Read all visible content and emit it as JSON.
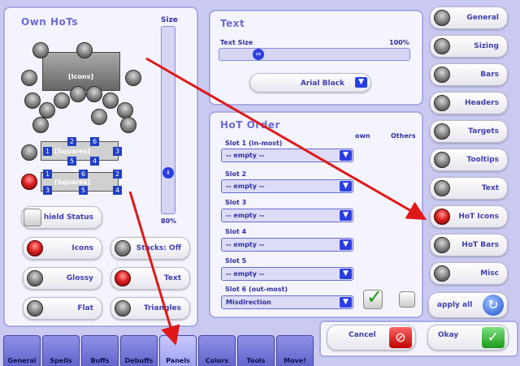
{
  "own_hots": {
    "title": "Own HoTs",
    "size_label": "Size",
    "size_value": "80%",
    "icons_label": "[Icons]",
    "squares_label": "[Squares]",
    "squares_row1_top": [
      "2",
      "6"
    ],
    "squares_row1_mid": [
      "1",
      "3"
    ],
    "squares_row1_bot": [
      "5",
      "4"
    ],
    "squares_row2_top": [
      "1",
      "6",
      "2"
    ],
    "squares_row2_bot": [
      "3",
      "5",
      "4"
    ],
    "shield_label": "hield Status",
    "toggles": [
      {
        "label": "Icons",
        "state": "red"
      },
      {
        "label": "Stacks: Off",
        "state": "grey"
      },
      {
        "label": "Glossy",
        "state": "grey"
      },
      {
        "label": "Text",
        "state": "red"
      },
      {
        "label": "Flat",
        "state": "grey"
      },
      {
        "label": "Triangles",
        "state": "grey"
      }
    ]
  },
  "text_panel": {
    "title": "Text",
    "size_label": "Text Size",
    "size_value": "100%",
    "font_value": "Arial Black"
  },
  "hot_order": {
    "title": "HoT Order",
    "col_own": "own",
    "col_others": "Others",
    "slots": [
      {
        "label": "Slot 1 (in-most)",
        "value": "-- empty --"
      },
      {
        "label": "Slot 2",
        "value": "-- empty --"
      },
      {
        "label": "Slot 3",
        "value": "-- empty --"
      },
      {
        "label": "Slot 4",
        "value": "-- empty --"
      },
      {
        "label": "Slot 5",
        "value": "-- empty --"
      },
      {
        "label": "Slot 6 (out-most)",
        "value": "Misdirection"
      }
    ]
  },
  "categories": [
    {
      "label": "General",
      "state": "grey"
    },
    {
      "label": "Sizing",
      "state": "grey"
    },
    {
      "label": "Bars",
      "state": "grey"
    },
    {
      "label": "Headers",
      "state": "grey"
    },
    {
      "label": "Targets",
      "state": "grey"
    },
    {
      "label": "Tooltips",
      "state": "grey"
    },
    {
      "label": "Text",
      "state": "grey"
    },
    {
      "label": "HoT Icons",
      "state": "red"
    },
    {
      "label": "HoT Bars",
      "state": "grey"
    },
    {
      "label": "Misc",
      "state": "grey"
    }
  ],
  "apply_all": "apply all",
  "cancel": "Cancel",
  "okay": "Okay",
  "tabs": [
    "General",
    "Spells",
    "Buffs",
    "Debuffs",
    "Panels",
    "Colors",
    "Tools",
    "Move!"
  ],
  "active_tab": "Panels",
  "colors": {
    "arrow": "#e01818",
    "accent": "#6b6bd6"
  }
}
